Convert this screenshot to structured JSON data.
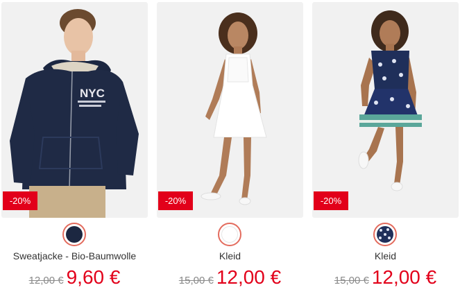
{
  "products": [
    {
      "name": "Sweatjacke - Bio-Baumwolle",
      "discount": "-20%",
      "old_price": "12,00 €",
      "new_price": "9,60 €",
      "swatch_color": "#1c2741",
      "image_icon": "boy-hoodie-photo"
    },
    {
      "name": "Kleid",
      "discount": "-20%",
      "old_price": "15,00 €",
      "new_price": "12,00 €",
      "swatch_color": "#ffffff",
      "image_icon": "girl-white-dress-photo"
    },
    {
      "name": "Kleid",
      "discount": "-20%",
      "old_price": "15,00 €",
      "new_price": "12,00 €",
      "swatch_color": "#1f2f5a",
      "image_icon": "girl-patterned-dress-photo"
    }
  ],
  "theme": {
    "sale_red": "#e2001a",
    "swatch_ring": "#e36b5d",
    "photo_bg": "#f1f1f1"
  }
}
